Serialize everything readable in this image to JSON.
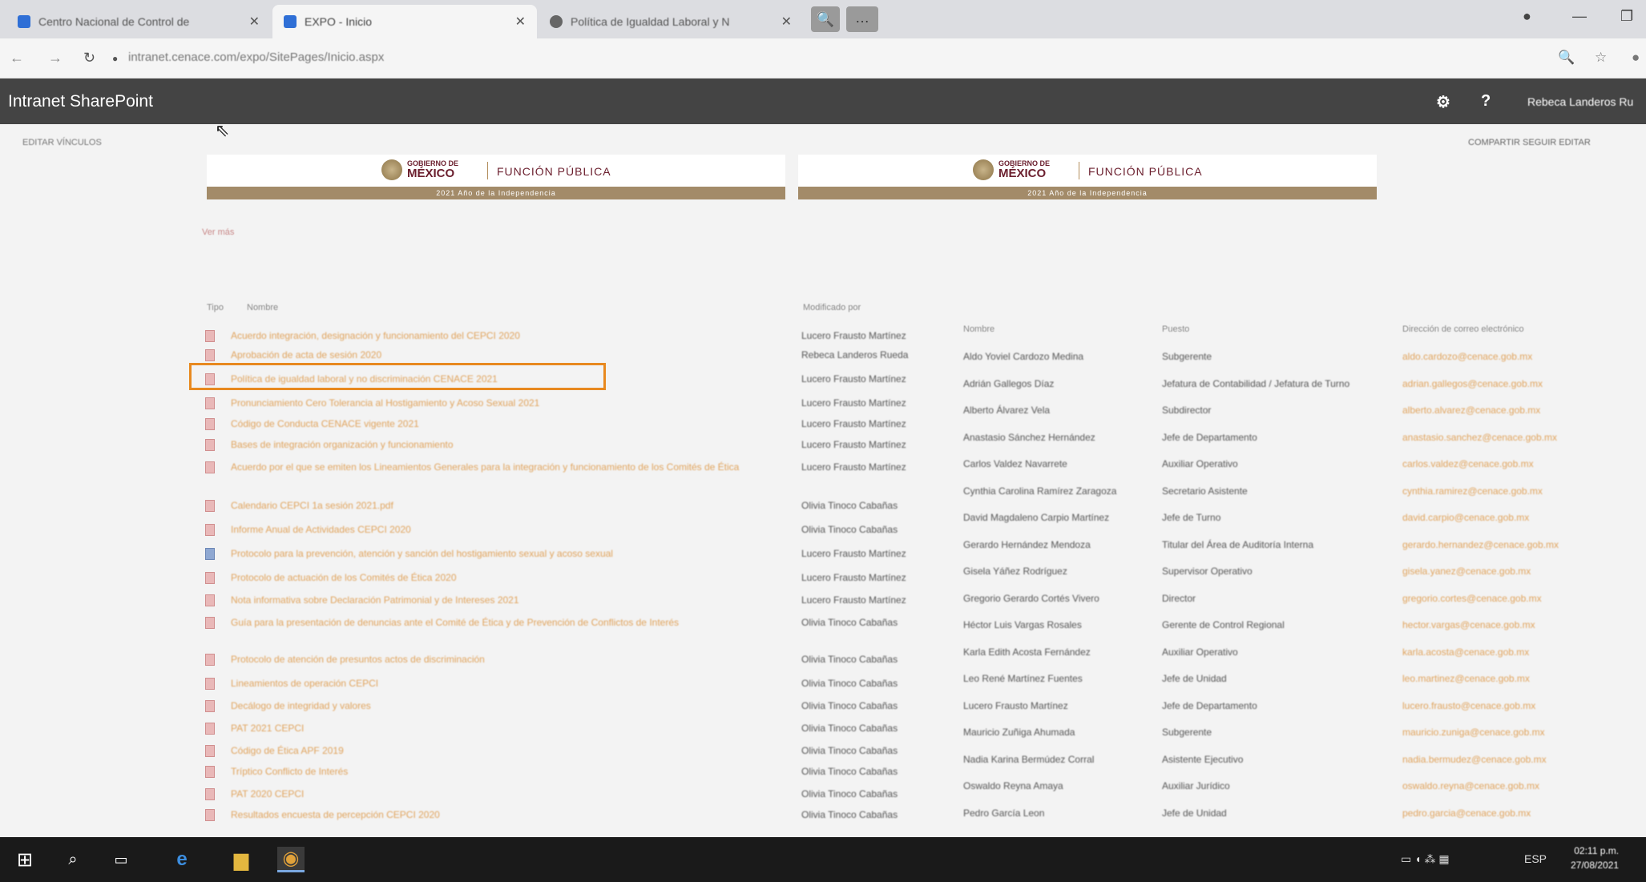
{
  "browser": {
    "tabs": [
      {
        "title": "Centro Nacional de Control de",
        "close": "✕"
      },
      {
        "title": "EXPO - Inicio",
        "close": "✕"
      },
      {
        "title": "Política de Igualdad Laboral y N",
        "close": "✕"
      }
    ],
    "url": "intranet.cenace.com/expo/SitePages/Inicio.aspx"
  },
  "suite": {
    "brand": "Intranet SharePoint",
    "user": "Rebeca Landeros Ru"
  },
  "page": {
    "crumbs": "EDITAR   VÍNCULOS",
    "actions": "COMPARTIR   SEGUIR   EDITAR",
    "banner": {
      "gob_small": "GOBIERNO DE",
      "gob_big": "MÉXICO",
      "dependencia": "FUNCIÓN PÚBLICA",
      "strip": "2021 Año de la Independencia"
    },
    "small_link": "Ver más"
  },
  "documents": {
    "col_type": "Tipo",
    "col_name": "Nombre",
    "col_modified_by": "Modificado por",
    "items": [
      {
        "name": "Acuerdo integración, designación y funcionamiento del CEPCI 2020",
        "by": "Lucero Frausto Martínez",
        "icon": "pdf"
      },
      {
        "name": "Aprobación de acta de sesión 2020",
        "by": "Rebeca Landeros Rueda",
        "icon": "pdf"
      },
      {
        "name": "Política de igualdad laboral y no discriminación CENACE 2021",
        "by": "Lucero Frausto Martínez",
        "icon": "pdf"
      },
      {
        "name": "Pronunciamiento Cero Tolerancia al Hostigamiento y Acoso Sexual 2021",
        "by": "Lucero Frausto Martínez",
        "icon": "pdf"
      },
      {
        "name": "Código de Conducta CENACE vigente 2021",
        "by": "Lucero Frausto Martínez",
        "icon": "pdf"
      },
      {
        "name": "Bases de integración organización y funcionamiento",
        "by": "Lucero Frausto Martínez",
        "icon": "pdf"
      },
      {
        "name": "Acuerdo por el que se emiten los Lineamientos Generales para la integración y funcionamiento de los Comités de Ética",
        "by": "Lucero Frausto Martínez",
        "icon": "pdf"
      },
      {
        "name": "Calendario CEPCI 1a sesión 2021.pdf",
        "by": "Olivia Tinoco Cabañas",
        "icon": "pdf"
      },
      {
        "name": "Informe Anual de Actividades CEPCI 2020",
        "by": "Olivia Tinoco Cabañas",
        "icon": "pdf"
      },
      {
        "name": "Protocolo para la prevención, atención y sanción del hostigamiento sexual y acoso sexual",
        "by": "Lucero Frausto Martínez",
        "icon": "word"
      },
      {
        "name": "Protocolo de actuación de los Comités de Ética 2020",
        "by": "Lucero Frausto Martínez",
        "icon": "pdf"
      },
      {
        "name": "Nota informativa sobre Declaración Patrimonial y de Intereses 2021",
        "by": "Lucero Frausto Martínez",
        "icon": "pdf"
      },
      {
        "name": "Guía para la presentación de denuncias ante el Comité de Ética y de Prevención de Conflictos de Interés",
        "by": "Olivia Tinoco Cabañas",
        "icon": "pdf"
      },
      {
        "name": "Protocolo de atención de presuntos actos de discriminación",
        "by": "Olivia Tinoco Cabañas",
        "icon": "pdf"
      },
      {
        "name": "Lineamientos de operación CEPCI",
        "by": "Olivia Tinoco Cabañas",
        "icon": "pdf"
      },
      {
        "name": "Decálogo de integridad y valores",
        "by": "Olivia Tinoco Cabañas",
        "icon": "pdf"
      },
      {
        "name": "PAT 2021 CEPCI",
        "by": "Olivia Tinoco Cabañas",
        "icon": "pdf"
      },
      {
        "name": "Código de Ética APF 2019",
        "by": "Olivia Tinoco Cabañas",
        "icon": "pdf"
      },
      {
        "name": "Tríptico Conflicto de Interés",
        "by": "Olivia Tinoco Cabañas",
        "icon": "pdf"
      },
      {
        "name": "PAT 2020 CEPCI",
        "by": "Olivia Tinoco Cabañas",
        "icon": "pdf"
      },
      {
        "name": "Resultados encuesta de percepción CEPCI 2020",
        "by": "Olivia Tinoco Cabañas",
        "icon": "pdf"
      }
    ]
  },
  "directory": {
    "col_name": "Nombre",
    "col_position": "Puesto",
    "col_email": "Dirección de correo electrónico",
    "rows": [
      {
        "name": "Aldo Yoviel Cardozo Medina",
        "position": "Subgerente",
        "email": "aldo.cardozo@cenace.gob.mx"
      },
      {
        "name": "Adrián Gallegos Díaz",
        "position": "Jefatura de Contabilidad / Jefatura de Turno",
        "email": "adrian.gallegos@cenace.gob.mx"
      },
      {
        "name": "Alberto Álvarez Vela",
        "position": "Subdirector",
        "email": "alberto.alvarez@cenace.gob.mx"
      },
      {
        "name": "Anastasio Sánchez Hernández",
        "position": "Jefe de Departamento",
        "email": "anastasio.sanchez@cenace.gob.mx"
      },
      {
        "name": "Carlos Valdez Navarrete",
        "position": "Auxiliar Operativo",
        "email": "carlos.valdez@cenace.gob.mx"
      },
      {
        "name": "Cynthia Carolina Ramírez Zaragoza",
        "position": "Secretario Asistente",
        "email": "cynthia.ramirez@cenace.gob.mx"
      },
      {
        "name": "David Magdaleno Carpio Martínez",
        "position": "Jefe de Turno",
        "email": "david.carpio@cenace.gob.mx"
      },
      {
        "name": "Gerardo Hernández Mendoza",
        "position": "Titular del Área de Auditoría Interna",
        "email": "gerardo.hernandez@cenace.gob.mx"
      },
      {
        "name": "Gisela Yáñez Rodríguez",
        "position": "Supervisor Operativo",
        "email": "gisela.yanez@cenace.gob.mx"
      },
      {
        "name": "Gregorio Gerardo Cortés Vivero",
        "position": "Director",
        "email": "gregorio.cortes@cenace.gob.mx"
      },
      {
        "name": "Héctor Luis Vargas Rosales",
        "position": "Gerente de Control Regional",
        "email": "hector.vargas@cenace.gob.mx"
      },
      {
        "name": "Karla Edith Acosta Fernández",
        "position": "Auxiliar Operativo",
        "email": "karla.acosta@cenace.gob.mx"
      },
      {
        "name": "Leo René Martínez Fuentes",
        "position": "Jefe de Unidad",
        "email": "leo.martinez@cenace.gob.mx"
      },
      {
        "name": "Lucero Frausto Martínez",
        "position": "Jefe de Departamento",
        "email": "lucero.frausto@cenace.gob.mx"
      },
      {
        "name": "Mauricio Zuñiga Ahumada",
        "position": "Subgerente",
        "email": "mauricio.zuniga@cenace.gob.mx"
      },
      {
        "name": "Nadia Karina Bermúdez Corral",
        "position": "Asistente Ejecutivo",
        "email": "nadia.bermudez@cenace.gob.mx"
      },
      {
        "name": "Oswaldo Reyna Amaya",
        "position": "Auxiliar Jurídico",
        "email": "oswaldo.reyna@cenace.gob.mx"
      },
      {
        "name": "Pedro García Leon",
        "position": "Jefe de Unidad",
        "email": "pedro.garcia@cenace.gob.mx"
      }
    ]
  },
  "taskbar": {
    "lang": "ESP",
    "time": "02:11 p.m.",
    "date": "27/08/2021"
  }
}
